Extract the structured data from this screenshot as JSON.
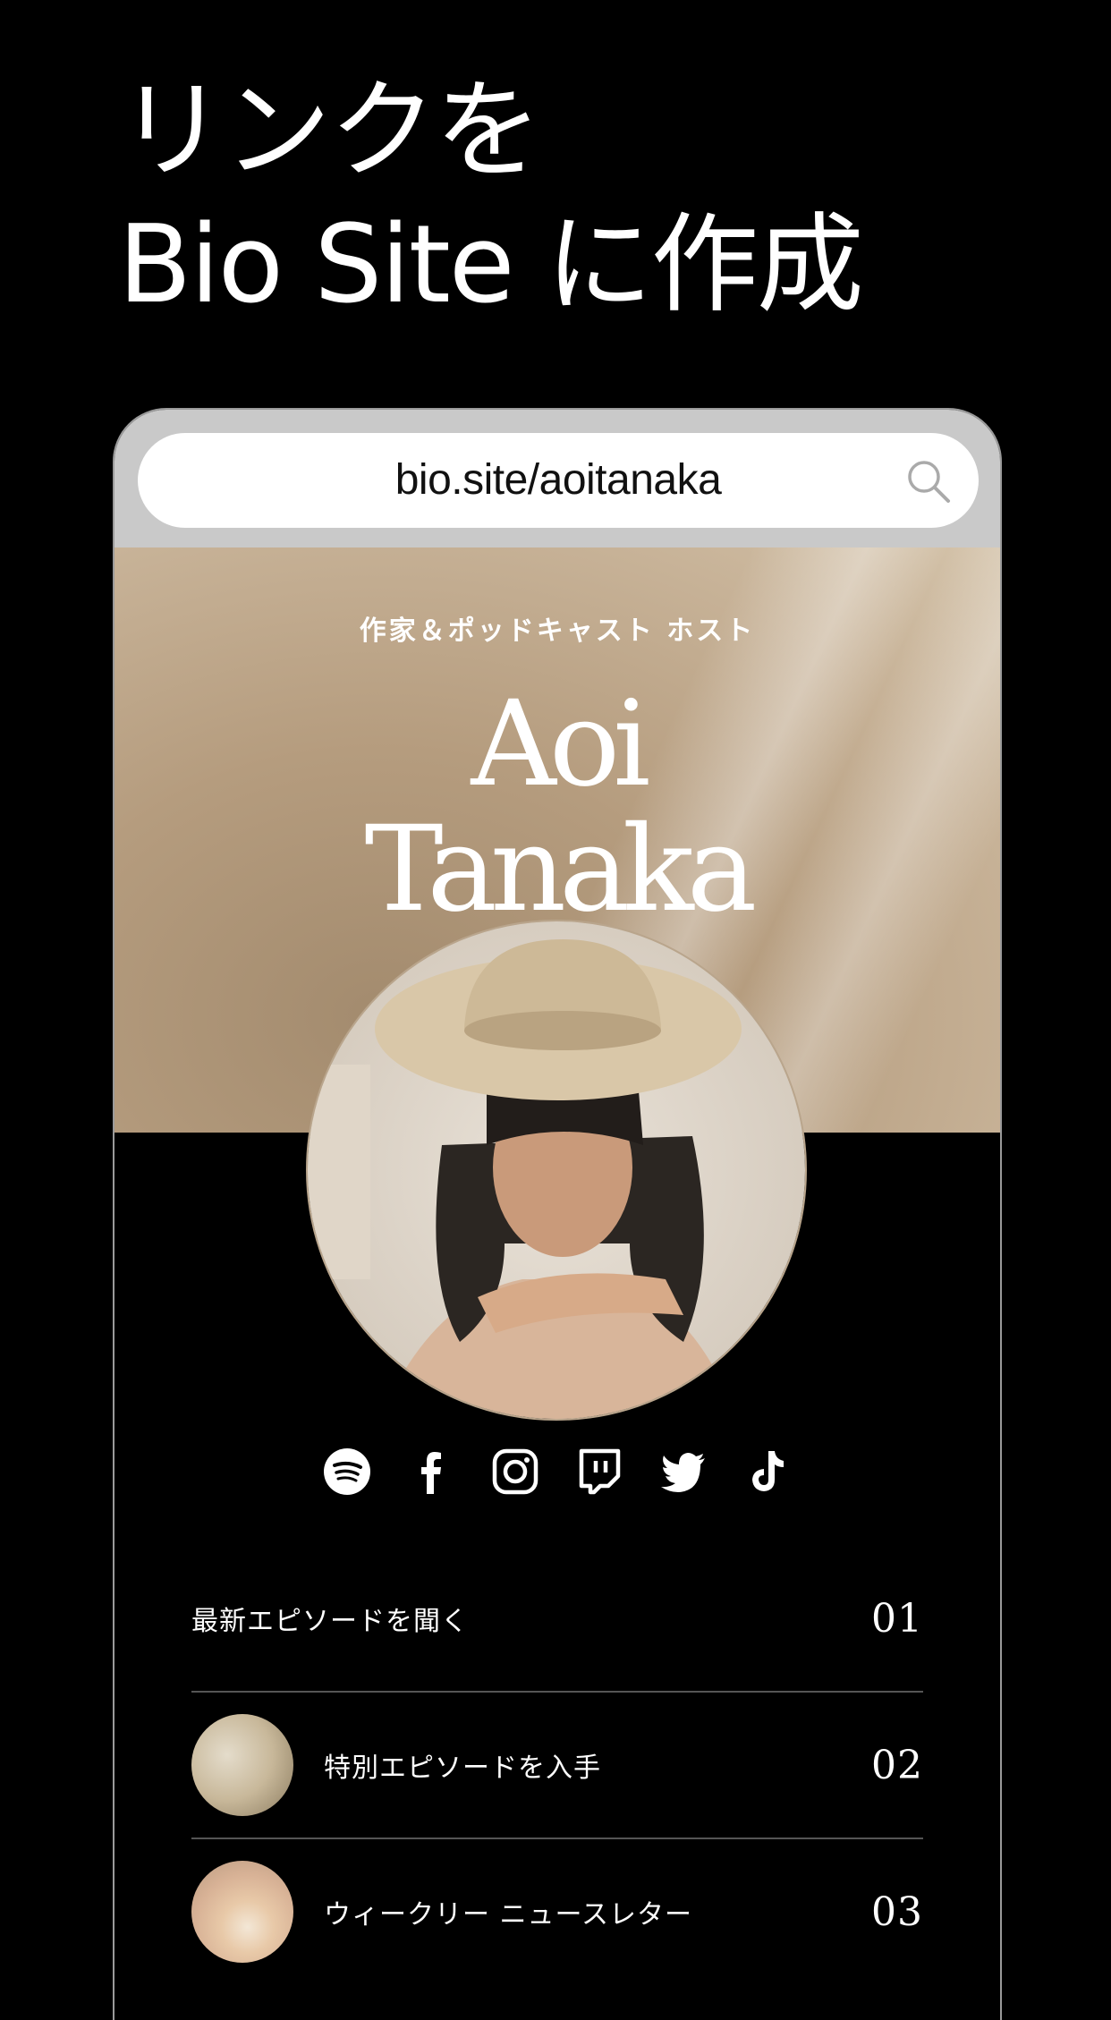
{
  "headline": {
    "line1": "リンクを",
    "line2": "Bio Site に作成"
  },
  "browser": {
    "url": "bio.site/aoitanaka",
    "search_icon": "search-icon"
  },
  "profile": {
    "subtitle": "作家＆ポッドキャスト ホスト",
    "first_name": "Aoi",
    "last_name": "Tanaka"
  },
  "socials": [
    {
      "name": "spotify-icon"
    },
    {
      "name": "facebook-icon"
    },
    {
      "name": "instagram-icon"
    },
    {
      "name": "twitch-icon"
    },
    {
      "name": "twitter-icon"
    },
    {
      "name": "tiktok-icon"
    }
  ],
  "links": [
    {
      "label": "最新エピソードを聞く",
      "number": "01"
    },
    {
      "label": "特別エピソードを入手",
      "number": "02"
    },
    {
      "label": "ウィークリー ニュースレター",
      "number": "03"
    }
  ]
}
